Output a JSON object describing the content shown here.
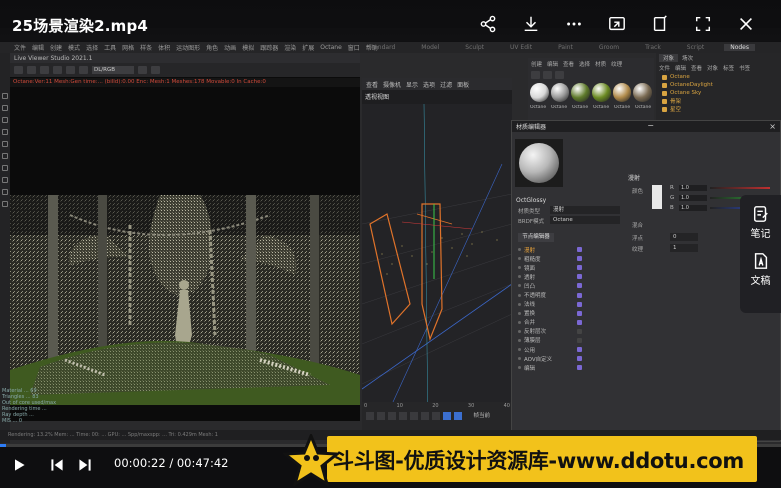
{
  "video": {
    "title": "25场景渲染2.mp4",
    "time_current": "00:00:22",
    "time_total": "00:47:42",
    "progress_fraction": 0.0077
  },
  "menubar": {
    "items": [
      "文件",
      "编辑",
      "创建",
      "模式",
      "选择",
      "工具",
      "网格",
      "样条",
      "体积",
      "运动图形",
      "角色",
      "动画",
      "模拟",
      "跟踪器",
      "渲染",
      "扩展",
      "Octane",
      "窗口",
      "帮助"
    ],
    "layout_tabs": [
      "Standard",
      "Model",
      "Sculpt",
      "UV Edit",
      "Paint",
      "Groom",
      "Track",
      "Script",
      "Nodes"
    ]
  },
  "viewer": {
    "title": "Live Viewer Studio 2021.1",
    "mode": "DL/RGB",
    "status_line": "Octane:Ver:11   Mesh:Gen time:... (billd):0.00 Enc: Mesh:1 Meshes:178 Movable:0 In Cache:0",
    "stats": [
      "Material   ...   69",
      "Triangles  ...   83",
      "Out of core used/max",
      "Rendering  time ...",
      "Ray depth  ...",
      "MIS  ...  0"
    ]
  },
  "viewport": {
    "label": "透视视图",
    "menu": [
      "查看",
      "摄像机",
      "显示",
      "选项",
      "过滤",
      "面板"
    ],
    "frame_label": "帧当前",
    "tl_numbers": [
      "0",
      "10",
      "20",
      "30",
      "40"
    ],
    "frame_field": "0 F"
  },
  "material_manager": {
    "menu": [
      "创建",
      "编辑",
      "查看",
      "选择",
      "材质",
      "纹理"
    ],
    "swatches": [
      {
        "label": "Octane",
        "color": "#d8d8d8"
      },
      {
        "label": "Octane",
        "color": "#9a9a9a"
      },
      {
        "label": "Octane",
        "color": "#5e7a2a"
      },
      {
        "label": "Octane",
        "color": "#6b8a22"
      },
      {
        "label": "Octane",
        "color": "#b08a4a"
      },
      {
        "label": "Octane",
        "color": "#7a6a52"
      }
    ]
  },
  "object_manager": {
    "tabs": [
      "对象",
      "场次"
    ],
    "menu": [
      "文件",
      "编辑",
      "查看",
      "对象",
      "标签",
      "书签"
    ],
    "rows": [
      "Octane",
      "OctaneDaylight",
      "Octane Sky",
      "骨架",
      "星空"
    ]
  },
  "material_editor": {
    "title": "材质编辑器",
    "name": "OctGlossy",
    "node_label": "材质类型",
    "node_value": "漫射",
    "bitmap_label": "BRDF模式",
    "bitmap_value": "Octane",
    "button": "节点编辑器",
    "section_title": "漫射",
    "color_label": "颜色",
    "channels": [
      {
        "name": "漫射",
        "on": true,
        "active": true
      },
      {
        "name": "粗糙度",
        "on": true
      },
      {
        "name": "镜面",
        "on": true
      },
      {
        "name": "透射",
        "on": true
      },
      {
        "name": "凹凸",
        "on": true
      },
      {
        "name": "不透明度",
        "on": true
      },
      {
        "name": "法线",
        "on": true
      },
      {
        "name": "置换",
        "on": true
      },
      {
        "name": "合并",
        "on": true
      },
      {
        "name": "反射层次",
        "on": false
      },
      {
        "name": "薄膜层",
        "on": false
      },
      {
        "name": "公用",
        "on": true
      },
      {
        "name": "AOV自定义",
        "on": true
      },
      {
        "name": "编辑",
        "on": true
      }
    ],
    "rgb": [
      {
        "letter": "R",
        "value": "1.0",
        "bar": "#c03030"
      },
      {
        "letter": "G",
        "value": "1.0",
        "bar": "#2faa3a"
      },
      {
        "letter": "B",
        "value": "1.0",
        "bar": "#3050c8"
      }
    ],
    "mix_label": "混合",
    "float_label": "浮点",
    "texture_label": "纹理",
    "float_value": "0",
    "texture_value": "1"
  },
  "status_bar": "Rendering: 13.2%   Mem: ...   Time: 00: ...   GPU: ...   Spp/maxspp: ...   Tri: 0.429m   Mesh: 1",
  "side_widget": {
    "items": [
      {
        "label": "笔记",
        "icon": "note-icon"
      },
      {
        "label": "文稿",
        "icon": "document-icon"
      }
    ]
  },
  "banner": {
    "text": "斗斗图-优质设计资源库-www.ddotu.com"
  },
  "colors": {
    "accent_blue": "#2e7df6",
    "banner_yellow": "#f2c21b",
    "orange_highlight": "#e8a23a"
  }
}
